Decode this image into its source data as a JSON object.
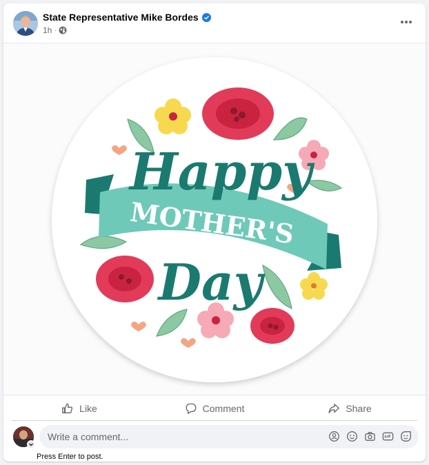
{
  "post": {
    "author": "State Representative Mike Bordes",
    "verified_icon": "verified-badge-icon",
    "time": "1h",
    "separator": "·",
    "audience_icon": "globe-icon",
    "more_icon": "more-options-icon"
  },
  "image": {
    "line1": "Happy",
    "line2": "MOTHER'S",
    "line3": "Day",
    "colors": {
      "teal_dark": "#1b7a6f",
      "teal_ribbon": "#6fc9b8",
      "rose": "#e23b5a",
      "yellow": "#f6d94e",
      "pink": "#f6aab6",
      "leaf": "#8cc9a3",
      "heart": "#f4a582"
    }
  },
  "actions": {
    "like": "Like",
    "comment": "Comment",
    "share": "Share"
  },
  "comment_box": {
    "placeholder": "Write a comment...",
    "hint": "Press Enter to post.",
    "icons": [
      "avatar-sticker-icon",
      "emoji-icon",
      "camera-icon",
      "gif-icon",
      "sticker-icon"
    ]
  },
  "colors": {
    "brand_blue": "#1877f2",
    "secondary_text": "#65676b",
    "divider": "#ced0d4"
  }
}
